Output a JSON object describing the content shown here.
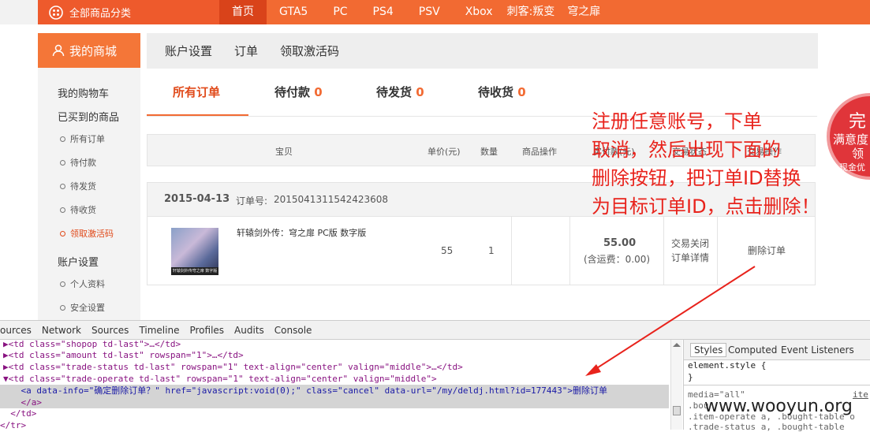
{
  "topnav": {
    "category": "全部商品分类",
    "items": [
      "首页",
      "GTA5",
      "PC",
      "PS4",
      "PSV",
      "Xbox",
      "刺客:叛变",
      "穹之扉"
    ],
    "active": "首页"
  },
  "sidebar": {
    "title": "我的商城",
    "cart": "我的购物车",
    "bought": "已买到的商品",
    "sub": [
      "所有订单",
      "待付款",
      "待发货",
      "待收货",
      "领取激活码"
    ],
    "account": "账户设置",
    "account_sub": [
      "个人资料",
      "安全设置"
    ]
  },
  "tabsbar": [
    "账户设置",
    "订单",
    "领取激活码"
  ],
  "order_tabs": [
    {
      "label": "所有订单",
      "count": ""
    },
    {
      "label": "待付款",
      "count": "0"
    },
    {
      "label": "待发货",
      "count": "0"
    },
    {
      "label": "待收货",
      "count": "0"
    }
  ],
  "table_head": [
    "宝贝",
    "单价(元)",
    "数量",
    "商品操作",
    "实付款(元)",
    "交易状态",
    "交易操作"
  ],
  "order": {
    "date": "2015-04-13",
    "no_label": "订单号:",
    "no": "2015041311542423608",
    "product": "轩辕剑外传：穹之扉 PC版 数字版",
    "price": "55",
    "qty": "1",
    "total": "55.00",
    "shipping": "(含运费：0.00)",
    "status": "交易关闭",
    "detail": "订单详情",
    "action": "删除订单",
    "thumb_caption": "轩辕剑外传穹之扉 数字版"
  },
  "annotation": [
    "注册任意账号，下单",
    "取消，然后出现下面的",
    "删除按钮，把订单ID替换",
    "为目标订单ID，点击删除！"
  ],
  "badge": [
    "完",
    "满意度",
    "领",
    "现金优"
  ],
  "devtools": {
    "tabs": [
      "ources",
      "Network",
      "Sources",
      "Timeline",
      "Profiles",
      "Audits",
      "Console"
    ],
    "lines": [
      "▶<td class=\"shopop td-last\">…</td>",
      "▶<td class=\"amount td-last\" rowspan=\"1\">…</td>",
      "▶<td class=\"trade-status td-last\" rowspan=\"1\" text-align=\"center\" valign=\"middle\">…</td>",
      "▼<td class=\"trade-operate td-last\" rowspan=\"1\" text-align=\"center\" valign=\"middle\">",
      "    <a data-info=\"确定删除订单？\" href=\"javascript:void(0);\" class=\"cancel\" data-url=\"/my/deldj.html?id=177443\">删除订单",
      "    </a>",
      "  </td>",
      "</tr>"
    ],
    "styles_tabs": [
      "Styles",
      "Computed",
      "Event Listeners"
    ],
    "styles_lines": [
      "element.style {",
      "}",
      "media=\"all\"",
      ".bou",
      ".item-operate a, .bought-table o",
      ".trade-status a, .bought-table"
    ],
    "styles_link": "ite"
  },
  "watermark": "www.wooyun.org",
  "colors": {
    "orange": "#f26a32",
    "red": "#e8231c"
  }
}
